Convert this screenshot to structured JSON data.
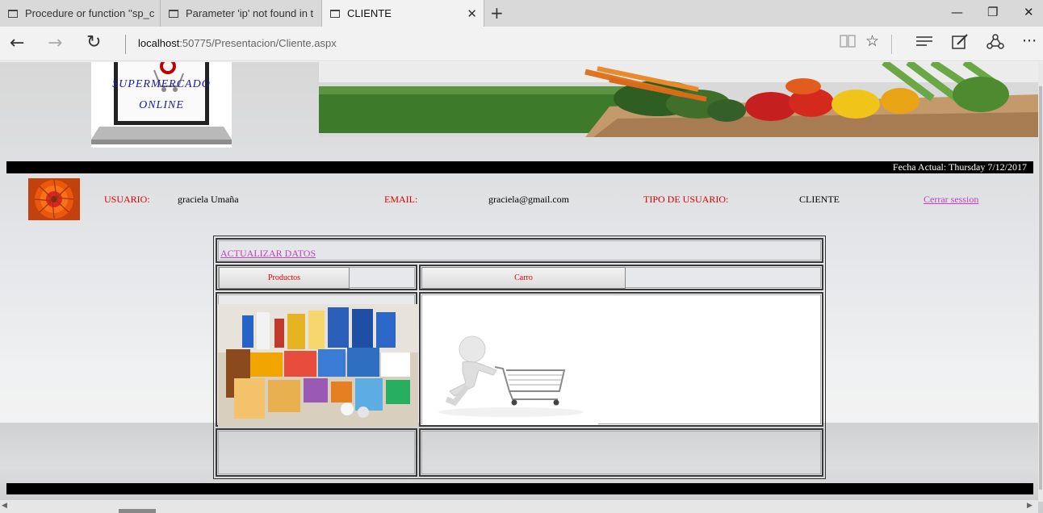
{
  "browser": {
    "tabs": [
      {
        "title": "Procedure or function ''sp_c",
        "active": false
      },
      {
        "title": "Parameter 'ip' not found in t",
        "active": false
      },
      {
        "title": "CLIENTE",
        "active": true
      }
    ],
    "url_host": "localhost",
    "url_rest": ":50775/Presentacion/Cliente.aspx"
  },
  "page": {
    "logo_line1": "SUPERMERCADO",
    "logo_line2": "ONLINE",
    "fecha": "Fecha Actual:  Thursday 7/12/2017",
    "user": {
      "usuario_label": "USUARIO:",
      "usuario_value": "graciela Umaña",
      "email_label": "EMAIL:",
      "email_value": "graciela@gmail.com",
      "tipo_label": "TIPO DE USUARIO:",
      "tipo_value": "CLIENTE",
      "logout": "Cerrar session"
    },
    "actualizar_link": "ACTUALIZAR DATOS",
    "productos_button": "Productos",
    "carro_button": "Carro"
  },
  "colors": {
    "label_red": "#e00000",
    "link_purple": "#c040c0"
  }
}
